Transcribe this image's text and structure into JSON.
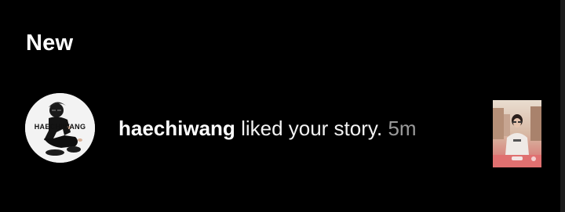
{
  "section": {
    "title": "New"
  },
  "notification": {
    "username": "haechiwang",
    "message": "liked your story.",
    "time": "5m",
    "avatar_brand_text": "HAECHIWANG"
  },
  "colors": {
    "background": "#000000",
    "text_primary": "#ffffff",
    "text_secondary": "#9a9a9a"
  }
}
